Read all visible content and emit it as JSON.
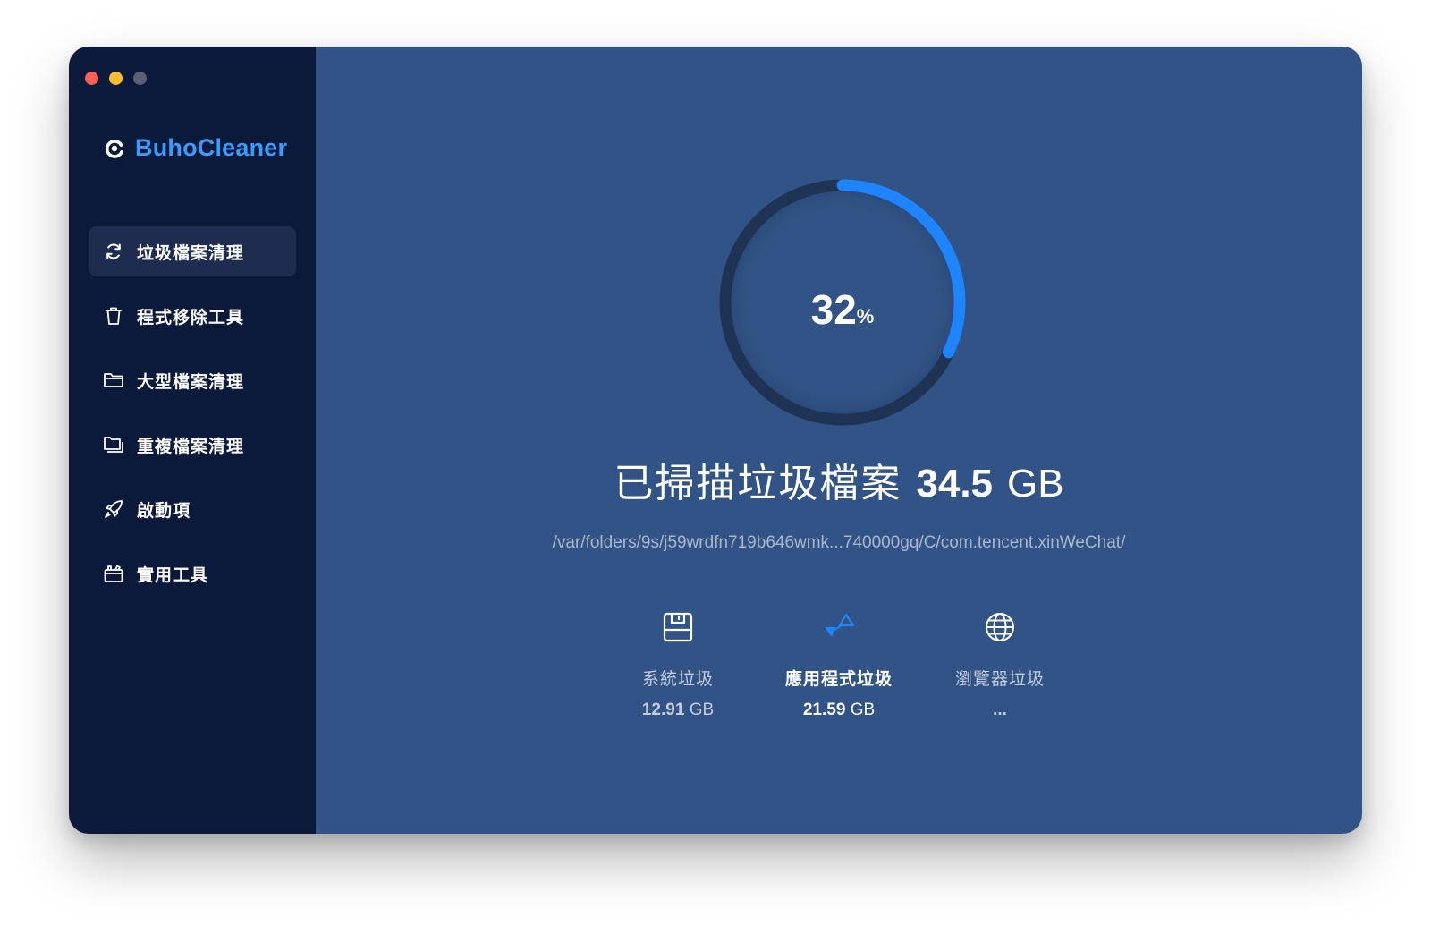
{
  "app": {
    "brand": "BuhoCleaner"
  },
  "window_controls": [
    "close",
    "minimize",
    "maximize"
  ],
  "sidebar": {
    "items": [
      {
        "label": "垃圾檔案清理",
        "icon": "refresh-icon",
        "active": true
      },
      {
        "label": "程式移除工具",
        "icon": "trash-icon",
        "active": false
      },
      {
        "label": "大型檔案清理",
        "icon": "folder-icon",
        "active": false
      },
      {
        "label": "重複檔案清理",
        "icon": "duplicate-folder-icon",
        "active": false
      },
      {
        "label": "啟動項",
        "icon": "rocket-icon",
        "active": false
      },
      {
        "label": "實用工具",
        "icon": "toolbox-icon",
        "active": false
      }
    ]
  },
  "scan": {
    "progress": 32,
    "percent_sign": "%",
    "headline_prefix": "已掃描垃圾檔案",
    "size_value": "34.5",
    "size_unit": "GB",
    "current_path": "/var/folders/9s/j59wrdfn719b646wmk...740000gq/C/com.tencent.xinWeChat/"
  },
  "stats": [
    {
      "label": "系統垃圾",
      "value": "12.91",
      "unit": "GB",
      "icon": "disk-icon"
    },
    {
      "label": "應用程式垃圾",
      "value": "21.59",
      "unit": "GB",
      "icon": "app-shapes-icon",
      "active": true
    },
    {
      "label": "瀏覽器垃圾",
      "value": "...",
      "unit": "",
      "icon": "globe-icon"
    }
  ],
  "colors": {
    "sidebar_bg": "#0b1a3a",
    "main_bg": "#325385",
    "accent": "#1e84ff",
    "brand": "#3d9bff",
    "ring_track": "#1f3454"
  }
}
